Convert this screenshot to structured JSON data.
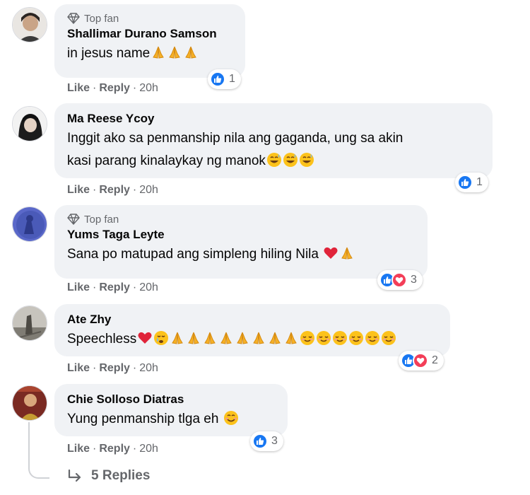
{
  "colors": {
    "bubble": "#f0f2f5",
    "meta_text": "#65676b",
    "like_blue": "#1877f2",
    "love_red": "#f33e58"
  },
  "comments": [
    {
      "author": "Shallimar Durano Samson",
      "badge": "Top fan",
      "text": "in jesus name",
      "emojis": [
        "folded-hands",
        "folded-hands",
        "folded-hands"
      ],
      "actions": {
        "like": "Like",
        "sep": "·",
        "reply": "Reply",
        "time": "20h"
      },
      "reactions": {
        "icons": [
          "like"
        ],
        "count": "1"
      }
    },
    {
      "author": "Ma Reese Ycoy",
      "badge": "",
      "text": "Inggit ako sa penmanship nila ang gaganda, ung sa akin",
      "text2": "kasi parang kinalaykay ng manok",
      "emojis": [
        "sweat-smile",
        "sweat-smile",
        "sweat-smile"
      ],
      "actions": {
        "like": "Like",
        "sep": "·",
        "reply": "Reply",
        "time": "20h"
      },
      "reactions": {
        "icons": [
          "like"
        ],
        "count": "1"
      }
    },
    {
      "author": "Yums Taga Leyte",
      "badge": "Top fan",
      "text": "Sana po matupad ang simpleng hiling Nila",
      "emojis": [
        "red-heart",
        "folded-hands"
      ],
      "actions": {
        "like": "Like",
        "sep": "·",
        "reply": "Reply",
        "time": "20h"
      },
      "reactions": {
        "icons": [
          "like",
          "love"
        ],
        "count": "3"
      }
    },
    {
      "author": "Ate Zhy",
      "badge": "",
      "text": "Speechless",
      "emojis": [
        "red-heart",
        "crying-face",
        "folded-hands",
        "folded-hands",
        "folded-hands",
        "folded-hands",
        "folded-hands",
        "folded-hands",
        "folded-hands",
        "folded-hands",
        "relieved-face",
        "relieved-face",
        "relieved-face",
        "relieved-face",
        "relieved-face",
        "relieved-face"
      ],
      "actions": {
        "like": "Like",
        "sep": "·",
        "reply": "Reply",
        "time": "20h"
      },
      "reactions": {
        "icons": [
          "like",
          "love"
        ],
        "count": "2"
      }
    },
    {
      "author": "Chie Solloso Diatras",
      "badge": "",
      "text": "Yung penmanship tlga eh",
      "emojis": [
        "smiling-face"
      ],
      "actions": {
        "like": "Like",
        "sep": "·",
        "reply": "Reply",
        "time": "20h"
      },
      "reactions": {
        "icons": [
          "like"
        ],
        "count": "3"
      }
    }
  ],
  "replies_link": {
    "label": "5 Replies",
    "icon": "reply-arrow-icon"
  }
}
